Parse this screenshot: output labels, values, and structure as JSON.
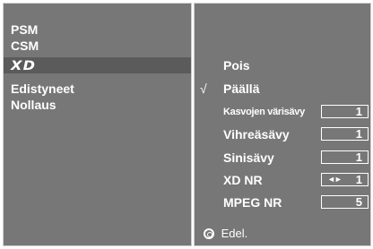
{
  "left_menu": {
    "items": [
      {
        "label": "PSM"
      },
      {
        "label": "CSM"
      },
      {
        "label": "XD",
        "selected": true
      },
      {
        "label": "Edistyneet"
      },
      {
        "label": "Nollaus"
      }
    ]
  },
  "right_menu": {
    "options": [
      {
        "label": "Pois",
        "checked": false
      },
      {
        "label": "Päällä",
        "checked": true,
        "check_mark": "√"
      }
    ],
    "settings": [
      {
        "label": "Kasvojen värisävy",
        "value": "1"
      },
      {
        "label": "Vihreäsävy",
        "value": "1"
      },
      {
        "label": "Sinisävy",
        "value": "1"
      },
      {
        "label": "XD NR",
        "value": "1",
        "arrows": "◄►"
      },
      {
        "label": "MPEG NR",
        "value": "5"
      }
    ]
  },
  "footer": {
    "label": "Edel.",
    "icon": "return-circle-icon"
  },
  "colors": {
    "panel_background": "#777777",
    "selected_background": "#5b5b5b",
    "text": "#ffffff",
    "border": "#cfcfcf"
  }
}
